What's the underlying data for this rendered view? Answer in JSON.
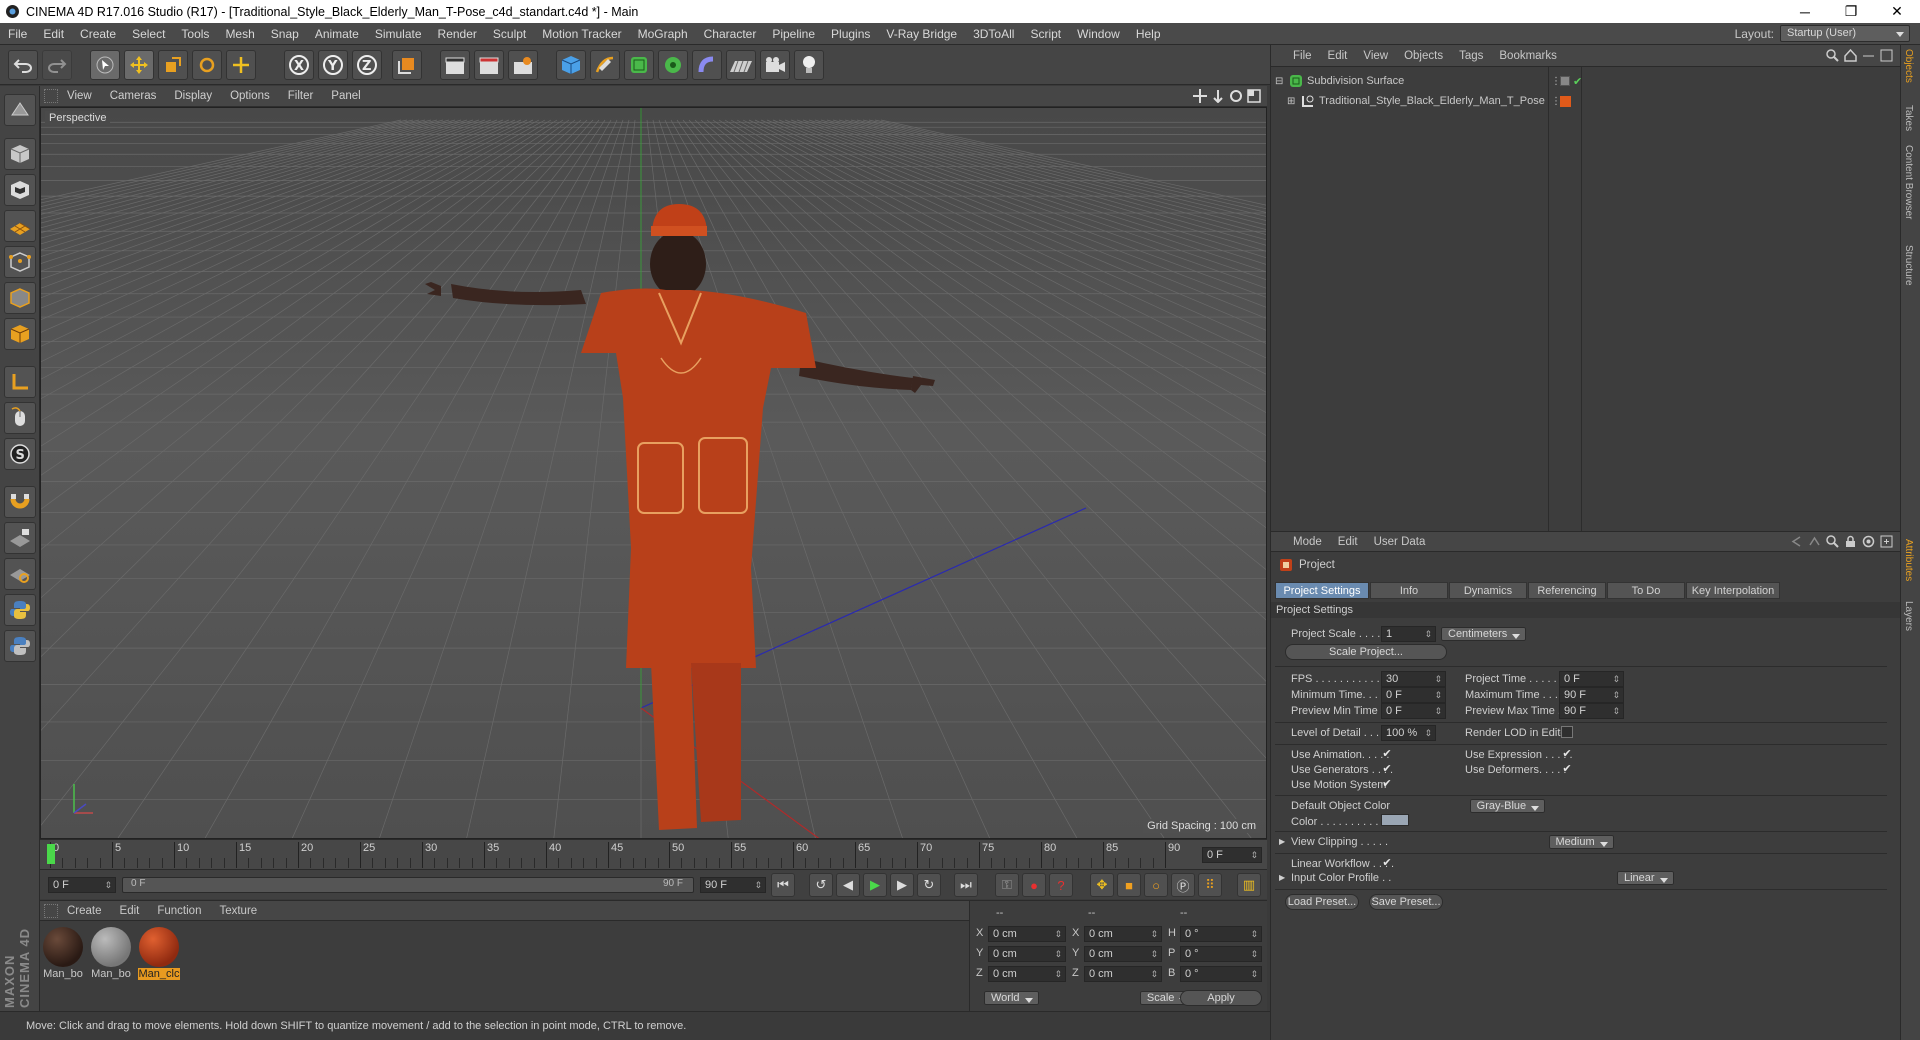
{
  "window": {
    "title": "CINEMA 4D R17.016 Studio (R17) - [Traditional_Style_Black_Elderly_Man_T-Pose_c4d_standart.c4d *] - Main",
    "minimize": "─",
    "maximize": "❐",
    "close": "✕"
  },
  "menubar": {
    "items": [
      "File",
      "Edit",
      "Create",
      "Select",
      "Tools",
      "Mesh",
      "Snap",
      "Animate",
      "Simulate",
      "Render",
      "Sculpt",
      "Motion Tracker",
      "MoGraph",
      "Character",
      "Pipeline",
      "Plugins",
      "V-Ray Bridge",
      "3DToAll",
      "Script",
      "Window",
      "Help"
    ],
    "layout_label": "Layout:",
    "layout_value": "Startup (User)"
  },
  "viewport": {
    "menu": [
      "View",
      "Cameras",
      "Display",
      "Options",
      "Filter",
      "Panel"
    ],
    "label": "Perspective",
    "grid_spacing": "Grid Spacing : 100 cm"
  },
  "timeline": {
    "ticks": [
      "0",
      "5",
      "10",
      "15",
      "20",
      "25",
      "30",
      "35",
      "40",
      "45",
      "50",
      "55",
      "60",
      "65",
      "70",
      "75",
      "80",
      "85",
      "90"
    ],
    "current_frame": "0 F",
    "start": "0 F",
    "range_start": "0 F",
    "range_end": "90 F",
    "end": "90 F"
  },
  "materials": {
    "menu": [
      "Create",
      "Edit",
      "Function",
      "Texture"
    ],
    "items": [
      {
        "label": "Man_bo",
        "color": "#3a2a24"
      },
      {
        "label": "Man_bo",
        "color": "#8a8a8a"
      },
      {
        "label": "Man_clc",
        "color": "#b4401a"
      }
    ]
  },
  "coordinates": {
    "headers": [
      "--",
      "--",
      "--"
    ],
    "rows": [
      {
        "axis1": "X",
        "val1": "0 cm",
        "axis2": "X",
        "val2": "0 cm",
        "axis3": "H",
        "val3": "0 °"
      },
      {
        "axis1": "Y",
        "val1": "0 cm",
        "axis2": "Y",
        "val2": "0 cm",
        "axis3": "P",
        "val3": "0 °"
      },
      {
        "axis1": "Z",
        "val1": "0 cm",
        "axis2": "Z",
        "val2": "0 cm",
        "axis3": "B",
        "val3": "0 °"
      }
    ],
    "world": "World",
    "scale": "Scale",
    "apply": "Apply"
  },
  "status": {
    "text": "Move: Click and drag to move elements. Hold down SHIFT to quantize movement / add to the selection in point mode, CTRL to remove."
  },
  "logo": {
    "text": "MAXON CINEMA 4D"
  },
  "objects": {
    "menu": [
      "File",
      "Edit",
      "View",
      "Objects",
      "Tags",
      "Bookmarks"
    ],
    "items": [
      {
        "name": "Subdivision Surface",
        "icon_color": "#6ac26a"
      },
      {
        "name": "Traditional_Style_Black_Elderly_Man_T_Pose",
        "icon_color": "#cccccc",
        "tag_color": "#e05a1a"
      }
    ]
  },
  "attributes": {
    "menu": [
      "Mode",
      "Edit",
      "User Data"
    ],
    "object": "Project",
    "tabs": [
      "Project Settings",
      "Info",
      "Dynamics",
      "Referencing",
      "To Do",
      "Key Interpolation"
    ],
    "section": "Project Settings",
    "project_scale_label": "Project Scale . . . . . .",
    "project_scale_value": "1",
    "units": "Centimeters",
    "scale_project_btn": "Scale Project...",
    "fps_label": "FPS . . . . . . . . . . . . . . .",
    "fps": "30",
    "project_time_label": "Project Time . . . . . . . .",
    "project_time": "0 F",
    "min_time_label": "Minimum Time. . . . . .",
    "min_time": "0 F",
    "max_time_label": "Maximum Time . . . . . .",
    "max_time": "90 F",
    "prev_min_label": "Preview Min Time . . .",
    "prev_min": "0 F",
    "prev_max_label": "Preview Max Time . . .",
    "prev_max": "90 F",
    "lod_label": "Level of Detail . . . . .",
    "lod": "100 %",
    "render_lod_label": "Render LOD in Editor",
    "use_anim_label": "Use Animation. . . . .",
    "use_expr_label": "Use Expression . . . . .",
    "use_gen_label": "Use Generators . . . .",
    "use_def_label": "Use Deformers. . . . .",
    "use_motion_label": "Use Motion System",
    "def_color_label": "Default Object Color",
    "def_color": "Gray-Blue",
    "color_label": "Color . . . . . . . . . . . .",
    "view_clip_label": "View Clipping . . . . .",
    "view_clip": "Medium",
    "lin_work_label": "Linear Workflow . . . .",
    "input_profile_label": "Input Color Profile . .",
    "input_profile": "Linear",
    "load_preset": "Load Preset...",
    "save_preset": "Save Preset...",
    "check": "✔"
  },
  "side_tabs": [
    "Objects",
    "Takes",
    "Content Browser",
    "Structure",
    "Attributes",
    "Layers"
  ]
}
